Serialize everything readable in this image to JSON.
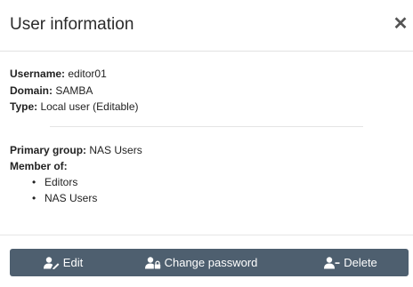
{
  "dialog": {
    "title": "User information",
    "close_icon": "close-icon"
  },
  "info": {
    "username_label": "Username:",
    "username_value": "editor01",
    "domain_label": "Domain:",
    "domain_value": "SAMBA",
    "type_label": "Type:",
    "type_value": "Local user (Editable)"
  },
  "groups": {
    "primary_label": "Primary group:",
    "primary_value": "NAS Users",
    "member_label": "Member of:",
    "members": [
      "Editors",
      "NAS Users"
    ]
  },
  "actions": {
    "edit_label": "Edit",
    "edit_icon": "user-edit-icon",
    "change_password_label": "Change password",
    "change_password_icon": "user-lock-icon",
    "delete_label": "Delete",
    "delete_icon": "user-minus-icon"
  },
  "colors": {
    "actionbar": "#4e5f6f"
  }
}
